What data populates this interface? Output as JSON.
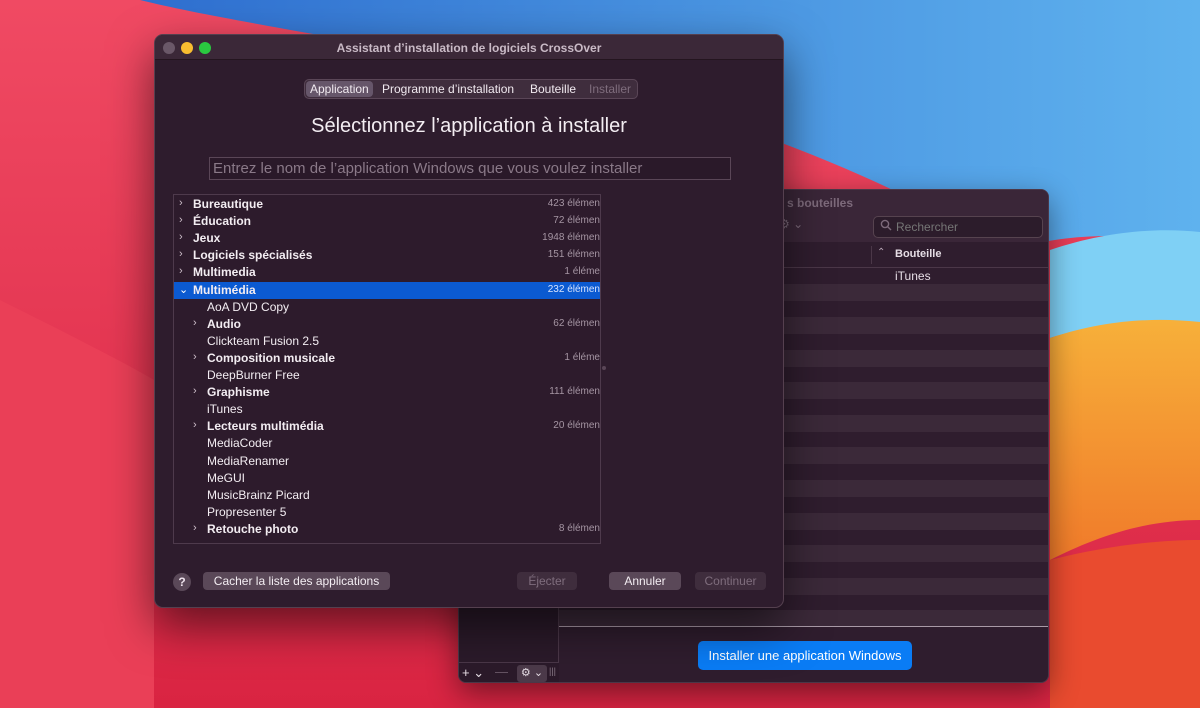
{
  "dialog": {
    "title": "Assistant d’installation de logiciels CrossOver",
    "steps": [
      "Application",
      "Programme d’installation",
      "Bouteille",
      "Installer"
    ],
    "active_step": "Application",
    "heading": "Sélectionnez l’application à installer",
    "search_placeholder": "Entrez le nom de l’application Windows que vous voulez installer",
    "tree": [
      {
        "label": "Bureautique",
        "count": "423 élémen",
        "bold": true,
        "level": 0,
        "chevron": "›"
      },
      {
        "label": "Éducation",
        "count": "72 élémen",
        "bold": true,
        "level": 0,
        "chevron": "›"
      },
      {
        "label": "Jeux",
        "count": "1948 élémen",
        "bold": true,
        "level": 0,
        "chevron": "›"
      },
      {
        "label": "Logiciels spécialisés",
        "count": "151 élémen",
        "bold": true,
        "level": 0,
        "chevron": "›"
      },
      {
        "label": "Multimedia",
        "count": "1 éléme",
        "bold": true,
        "level": 0,
        "chevron": "›"
      },
      {
        "label": "Multimédia",
        "count": "232 élémen",
        "bold": true,
        "level": 0,
        "chevron": "⌄",
        "selected": true
      },
      {
        "label": "AoA DVD Copy",
        "count": "",
        "bold": false,
        "level": 1,
        "chevron": ""
      },
      {
        "label": "Audio",
        "count": "62 élémen",
        "bold": true,
        "level": 1,
        "chevron": "›"
      },
      {
        "label": "Clickteam Fusion 2.5",
        "count": "",
        "bold": false,
        "level": 1,
        "chevron": ""
      },
      {
        "label": "Composition musicale",
        "count": "1 éléme",
        "bold": true,
        "level": 1,
        "chevron": "›"
      },
      {
        "label": "DeepBurner Free",
        "count": "",
        "bold": false,
        "level": 1,
        "chevron": ""
      },
      {
        "label": "Graphisme",
        "count": "111 élémen",
        "bold": true,
        "level": 1,
        "chevron": "›"
      },
      {
        "label": "iTunes",
        "count": "",
        "bold": false,
        "level": 1,
        "chevron": ""
      },
      {
        "label": "Lecteurs multimédia",
        "count": "20 élémen",
        "bold": true,
        "level": 1,
        "chevron": "›"
      },
      {
        "label": "MediaCoder",
        "count": "",
        "bold": false,
        "level": 1,
        "chevron": ""
      },
      {
        "label": "MediaRenamer",
        "count": "",
        "bold": false,
        "level": 1,
        "chevron": ""
      },
      {
        "label": "MeGUI",
        "count": "",
        "bold": false,
        "level": 1,
        "chevron": ""
      },
      {
        "label": "MusicBrainz Picard",
        "count": "",
        "bold": false,
        "level": 1,
        "chevron": ""
      },
      {
        "label": "Propresenter 5",
        "count": "",
        "bold": false,
        "level": 1,
        "chevron": ""
      },
      {
        "label": "Retouche photo",
        "count": "8 élémen",
        "bold": true,
        "level": 1,
        "chevron": "›"
      }
    ],
    "help_label": "?",
    "hide_list_label": "Cacher la liste des applications",
    "eject_label": "Éjecter",
    "cancel_label": "Annuler",
    "continue_label": "Continuer"
  },
  "back_window": {
    "title": "s bouteilles",
    "search_placeholder": "Rechercher",
    "column_header": "Bouteille",
    "rows": [
      "iTunes"
    ],
    "install_button_label": "Installer une application Windows",
    "add_label": "+ ⌄",
    "remove_label": "—",
    "gear_label": "⚙ ⌄"
  },
  "colors": {
    "accent": "#0a7cf5",
    "selection": "#0b5ad1",
    "window_bg": "#2e1c2d"
  }
}
